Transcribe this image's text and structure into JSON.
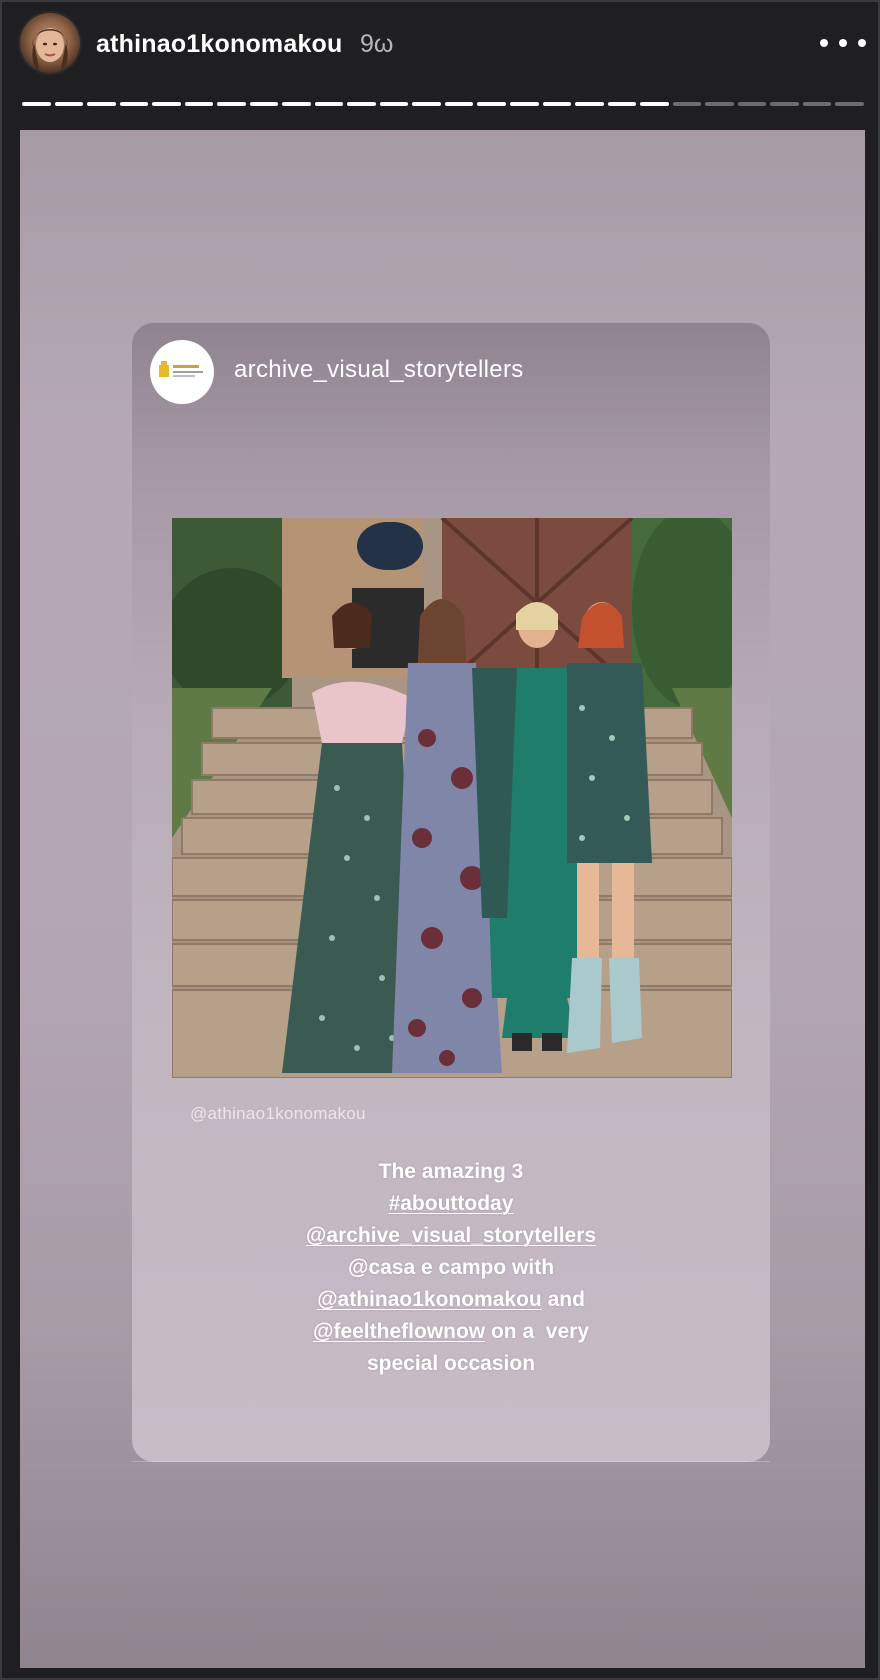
{
  "header": {
    "username": "athinao1konomakou",
    "time": "9ω",
    "more_icon": "more-horizontal-icon",
    "progress_segments_total": 26,
    "progress_segments_done": 20
  },
  "repost": {
    "account": "archive_visual_storytellers",
    "avatar_icon": "archive-logo-icon",
    "credit": "@athinao1konomakou",
    "caption": {
      "line1": "The amazing 3",
      "line2": "#abouttoday",
      "line3": "@archive_visual_storytellers",
      "line4": "@casa e campo with",
      "line5_tag": "@athinao1konomakou",
      "line5_rest": " and",
      "line6_tag": "@feeltheflownow",
      "line6_rest": " on a  very",
      "line7": "special occasion"
    }
  },
  "colors": {
    "background": "#1f1f21",
    "story_bg": "#b3a6b2",
    "card_bg": "#c1b5c0",
    "progress_active": "#ffffff",
    "progress_inactive": "#6d6d6f"
  }
}
